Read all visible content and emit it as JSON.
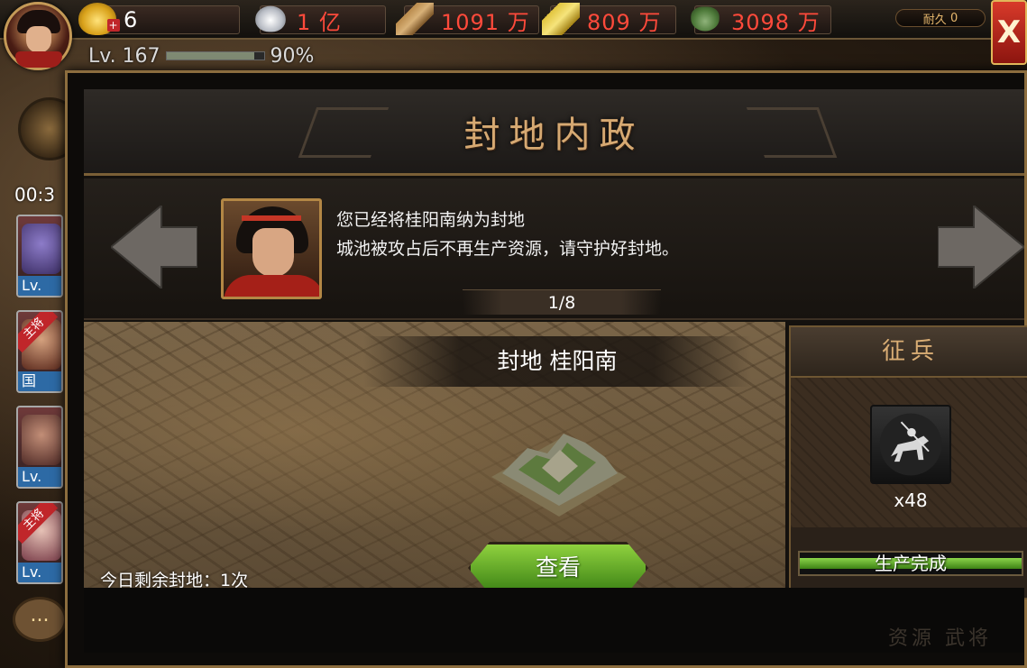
{
  "topbar": {
    "gold": "6",
    "silver": "1 亿",
    "wood": "1091 万",
    "food": "809 万",
    "iron": "3098 万",
    "level": "Lv. 167",
    "exp_percent": "90%",
    "durability_label": "耐久",
    "durability_value": "0",
    "close_label": "X"
  },
  "sidebar": {
    "timer": "00:3",
    "heroes": [
      {
        "lv": "Lv."
      },
      {
        "tag": "主将",
        "lv": "国"
      },
      {
        "lv": "Lv."
      },
      {
        "tag": "主将",
        "lv": "Lv."
      }
    ],
    "chat_label": "..."
  },
  "dialog": {
    "title": "封地内政",
    "message_line1": "您已经将桂阳南纳为封地",
    "message_line2": "城池被攻占后不再生产资源，请守护好封地。",
    "page_indicator": "1/8",
    "fief_name": "封地 桂阳南",
    "view_button": "查看",
    "remaining_label": "今日剩余封地：1次",
    "recruit": {
      "title": "征兵",
      "unit_count": "x48",
      "status": "生产完成"
    },
    "footer_ghost": "资源  武将"
  },
  "colors": {
    "accent_gold": "#d6a972",
    "resource_red": "#ff4a3b",
    "button_green": "#6fb42b",
    "close_red": "#c0262a"
  },
  "icons": {
    "gold": "gold-ingot-icon",
    "silver": "silver-ingot-icon",
    "wood": "wood-icon",
    "food": "grain-icon",
    "iron": "coin-bag-icon"
  }
}
